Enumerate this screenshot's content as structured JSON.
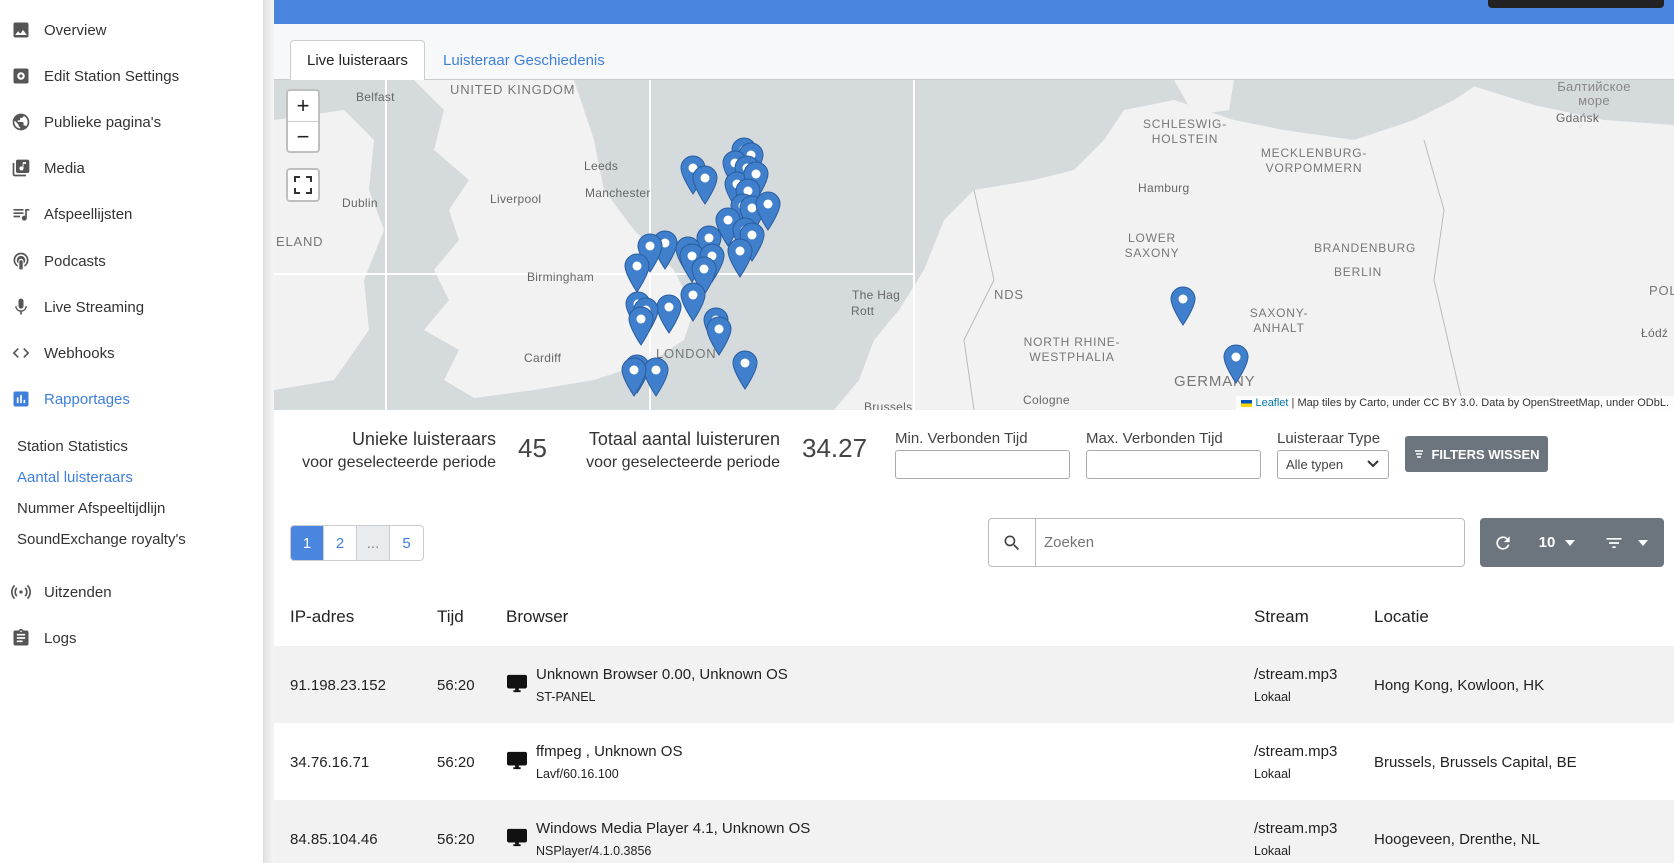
{
  "sidebar": {
    "items": [
      {
        "label": "Overview",
        "icon": "image-icon"
      },
      {
        "label": "Edit Station Settings",
        "icon": "settings-box-icon"
      },
      {
        "label": "Publieke pagina's",
        "icon": "globe-icon"
      },
      {
        "label": "Media",
        "icon": "library-music-icon"
      },
      {
        "label": "Afspeellijsten",
        "icon": "queue-music-icon"
      },
      {
        "label": "Podcasts",
        "icon": "podcast-icon"
      },
      {
        "label": "Live Streaming",
        "icon": "mic-icon"
      },
      {
        "label": "Webhooks",
        "icon": "code-icon"
      },
      {
        "label": "Rapportages",
        "icon": "bar-chart-icon"
      },
      {
        "label": "Uitzenden",
        "icon": "broadcast-icon"
      },
      {
        "label": "Logs",
        "icon": "clipboard-icon"
      }
    ],
    "subitems": [
      "Station Statistics",
      "Aantal luisteraars",
      "Nummer Afspeeltijdlijn",
      "SoundExchange royalty's"
    ]
  },
  "tabs": {
    "live": "Live luisteraars",
    "history": "Luisteraar Geschiedenis"
  },
  "map": {
    "zoom_in": "+",
    "zoom_out": "−",
    "labels": {
      "uk": "UNITED KINGDOM",
      "belfast": "Belfast",
      "leeds": "Leeds",
      "manchester": "Manchester",
      "liverpool": "Liverpool",
      "dublin": "Dublin",
      "eland": "ELAND",
      "birmingham": "Birmingham",
      "cardiff": "Cardiff",
      "london": "LONDON",
      "rotterdam": "Rott",
      "hague": "The Hag",
      "nds": "NDS",
      "brussels": "Brussels",
      "cologne": "Cologne",
      "germany": "GERMANY",
      "nrw": "NORTH RHINE-WESTPHALIA",
      "lower_saxony": "LOWER SAXONY",
      "hamburg": "Hamburg",
      "sh": "SCHLESWIG-HOLSTEIN",
      "mv": "MECKLENBURG-VORPOMMERN",
      "brandenburg": "BRANDENBURG",
      "berlin": "BERLIN",
      "saxony_anhalt": "SAXONY-ANHALT",
      "baltic": "Балтийское море",
      "gdansk": "Gdańsk",
      "poland": "POLAN",
      "lodz": "Łódź"
    },
    "attribution_link": "Leaflet",
    "attribution_text": " | Map tiles by Carto, under CC BY 3.0. Data by OpenStreetMap, under ODbL."
  },
  "stats": {
    "unique_label": "Unieke luisteraars",
    "unique_sub": "voor geselecteerde periode",
    "unique_value": "45",
    "hours_label": "Totaal aantal luisteruren",
    "hours_sub": "voor geselecteerde periode",
    "hours_value": "34.27"
  },
  "filters": {
    "min_label": "Min. Verbonden Tijd",
    "max_label": "Max. Verbonden Tijd",
    "type_label": "Luisteraar Type",
    "type_value": "Alle typen",
    "clear_label": "FILTERS WISSEN"
  },
  "pagination": [
    "1",
    "2",
    "...",
    "5"
  ],
  "search": {
    "placeholder": "Zoeken"
  },
  "toolbar": {
    "per_page": "10"
  },
  "table": {
    "headers": {
      "ip": "IP-adres",
      "time": "Tijd",
      "browser": "Browser",
      "stream": "Stream",
      "location": "Locatie"
    },
    "rows": [
      {
        "ip": "91.198.23.152",
        "time": "56:20",
        "browser": "Unknown Browser 0.00, Unknown OS",
        "agent": "ST-PANEL",
        "stream": "/stream.mp3",
        "stream_type": "Lokaal",
        "location": "Hong Kong, Kowloon, HK"
      },
      {
        "ip": "34.76.16.71",
        "time": "56:20",
        "browser": "ffmpeg , Unknown OS",
        "agent": "Lavf/60.16.100",
        "stream": "/stream.mp3",
        "stream_type": "Lokaal",
        "location": "Brussels, Brussels Capital, BE"
      },
      {
        "ip": "84.85.104.46",
        "time": "56:20",
        "browser": "Windows Media Player 4.1, Unknown OS",
        "agent": "NSPlayer/4.1.0.3856",
        "stream": "/stream.mp3",
        "stream_type": "Lokaal",
        "location": "Hoogeveen, Drenthe, NL"
      }
    ]
  },
  "colors": {
    "accent": "#4a86e0",
    "marker": "#3f7fcb",
    "button_gray": "#6c757d"
  }
}
